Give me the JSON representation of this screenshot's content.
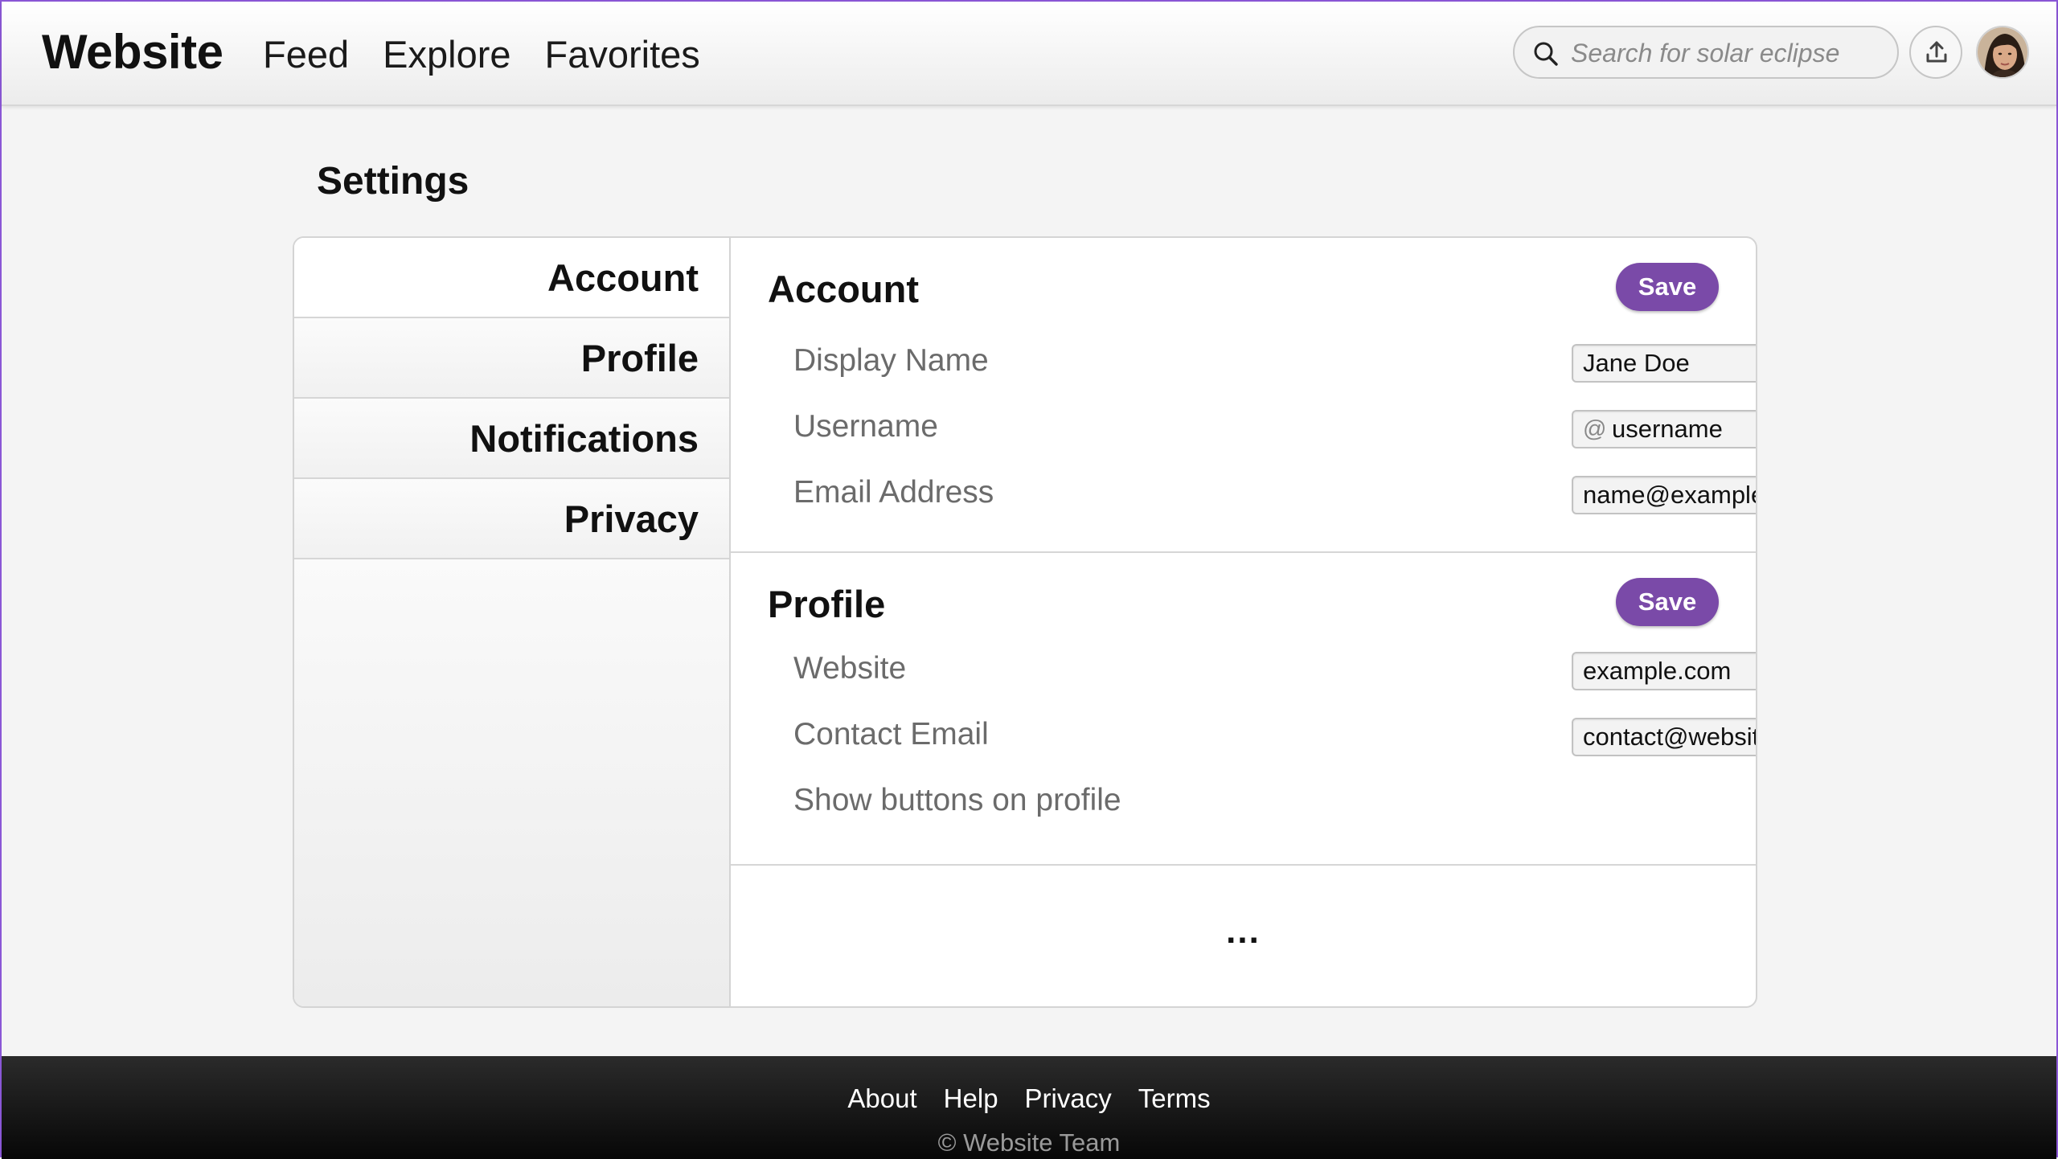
{
  "header": {
    "logo": "Website",
    "nav": [
      "Feed",
      "Explore",
      "Favorites"
    ],
    "search_placeholder": "Search for solar eclipse"
  },
  "page": {
    "title": "Settings"
  },
  "sidebar": {
    "items": [
      {
        "label": "Account"
      },
      {
        "label": "Profile"
      },
      {
        "label": "Notifications"
      },
      {
        "label": "Privacy"
      }
    ]
  },
  "account": {
    "title": "Account",
    "save_label": "Save",
    "display_name_label": "Display Name",
    "display_name_value": "Jane Doe",
    "username_label": "Username",
    "username_prefix": "@",
    "username_value": "username",
    "email_label": "Email Address",
    "email_value": "name@example.com"
  },
  "profile": {
    "title": "Profile",
    "save_label": "Save",
    "website_label": "Website",
    "website_value": "example.com",
    "contact_email_label": "Contact Email",
    "contact_email_value": "contact@website.com",
    "show_buttons_label": "Show buttons on profile",
    "show_buttons_on": true
  },
  "more_indicator": "...",
  "footer": {
    "links": [
      "About",
      "Help",
      "Privacy",
      "Terms"
    ],
    "copyright": "© Website Team"
  },
  "colors": {
    "accent": "#7a4aa8",
    "frame_border": "#8a57d6"
  }
}
